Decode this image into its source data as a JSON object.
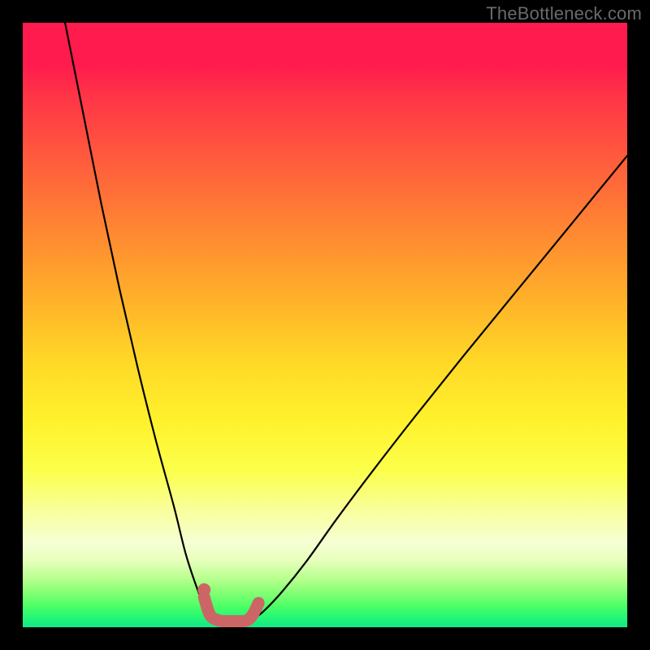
{
  "watermark": "TheBottleneck.com",
  "chart_data": {
    "type": "line",
    "title": "",
    "xlabel": "",
    "ylabel": "",
    "xlim": [
      0,
      100
    ],
    "ylim": [
      0,
      100
    ],
    "grid": false,
    "legend": false,
    "series": [
      {
        "name": "curve-left",
        "color": "#000000",
        "x": [
          7,
          10,
          13,
          16,
          19,
          22,
          25,
          27,
          29,
          30.5,
          31.5
        ],
        "values": [
          100,
          85,
          70,
          56,
          43,
          31,
          20,
          12,
          6,
          2.5,
          1.2
        ]
      },
      {
        "name": "curve-right",
        "color": "#000000",
        "x": [
          38,
          40,
          43,
          47,
          52,
          58,
          65,
          73,
          82,
          91,
          100
        ],
        "values": [
          1.2,
          2.8,
          6,
          11,
          18,
          26,
          35,
          45,
          56,
          67,
          78
        ]
      },
      {
        "name": "minimum-marker",
        "color": "#cc6666",
        "x": [
          30,
          31,
          32.5,
          34,
          35.5,
          37,
          38,
          39
        ],
        "values": [
          5,
          2,
          1.1,
          1,
          1,
          1.1,
          2,
          4
        ]
      }
    ],
    "scatter_points": [
      {
        "name": "marker-dot",
        "x": 30,
        "y": 6.2,
        "color": "#cc6666"
      }
    ],
    "gradient_stops": [
      {
        "pos": 0,
        "color": "#ff1b4d"
      },
      {
        "pos": 50,
        "color": "#ffd827"
      },
      {
        "pos": 80,
        "color": "#fcff4b"
      },
      {
        "pos": 100,
        "color": "#14e985"
      }
    ]
  }
}
